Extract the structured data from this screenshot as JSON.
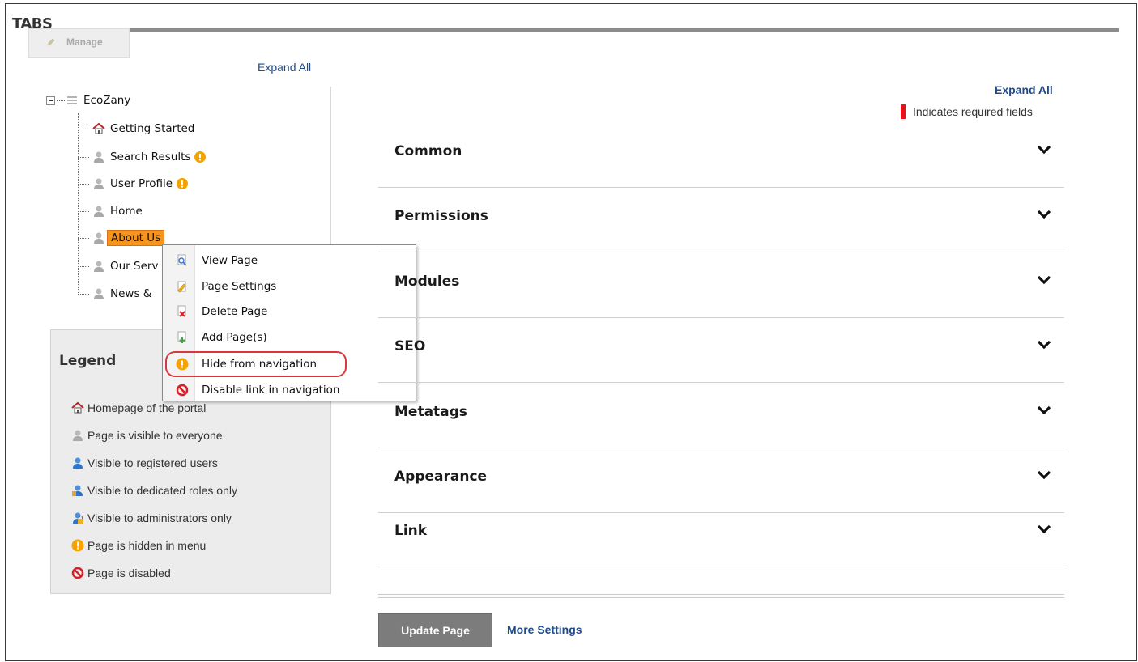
{
  "header": {
    "title": "TABS",
    "manage_label": "Manage",
    "expand_all_left": "Expand All"
  },
  "tree": {
    "root": "EcoZany",
    "items": [
      {
        "label": "Getting Started",
        "icon": "home-icon",
        "hidden": false,
        "selected": false
      },
      {
        "label": "Search Results",
        "icon": "page-visible-everyone-icon",
        "hidden": true,
        "selected": false
      },
      {
        "label": "User Profile",
        "icon": "page-visible-everyone-icon",
        "hidden": true,
        "selected": false
      },
      {
        "label": "Home",
        "icon": "page-visible-everyone-icon",
        "hidden": false,
        "selected": false
      },
      {
        "label": "About Us",
        "icon": "page-visible-everyone-icon",
        "hidden": false,
        "selected": true
      },
      {
        "label": "Our Serv",
        "icon": "page-visible-everyone-icon",
        "hidden": false,
        "selected": false
      },
      {
        "label": "News &",
        "icon": "page-visible-everyone-icon",
        "hidden": false,
        "selected": false
      }
    ]
  },
  "context_menu": {
    "items": [
      {
        "label": "View Page",
        "icon": "view-page-icon"
      },
      {
        "label": "Page Settings",
        "icon": "page-settings-icon"
      },
      {
        "label": "Delete Page",
        "icon": "delete-page-icon"
      },
      {
        "label": "Add Page(s)",
        "icon": "add-page-icon"
      },
      {
        "label": "Hide from navigation",
        "icon": "warning-icon"
      },
      {
        "label": "Disable link in navigation",
        "icon": "disabled-icon"
      }
    ],
    "highlighted_item": "Hide from navigation"
  },
  "legend": {
    "title": "Legend",
    "items": [
      {
        "label": "Homepage of the portal",
        "icon": "home-icon"
      },
      {
        "label": "Page is visible to everyone",
        "icon": "user-gray-icon"
      },
      {
        "label": "Visible to registered users",
        "icon": "user-blue-icon"
      },
      {
        "label": "Visible to dedicated roles only",
        "icon": "user-roles-icon"
      },
      {
        "label": "Visible to administrators only",
        "icon": "user-admin-icon"
      },
      {
        "label": "Page is hidden in menu",
        "icon": "warning-icon"
      },
      {
        "label": "Page is disabled",
        "icon": "disabled-icon"
      }
    ]
  },
  "panel": {
    "expand_all": "Expand All",
    "required_note": "Indicates required fields",
    "sections": [
      "Common",
      "Permissions",
      "Modules",
      "SEO",
      "Metatags",
      "Appearance",
      "Link"
    ]
  },
  "footer": {
    "update_button": "Update Page",
    "more_settings": "More Settings"
  },
  "colors": {
    "selected_node": "#f7941d",
    "link": "#1f4c8c",
    "required_marker": "#e8121b",
    "highlight_ring": "#d9373b",
    "warning": "#f5a300",
    "disabled": "#d61f26"
  }
}
